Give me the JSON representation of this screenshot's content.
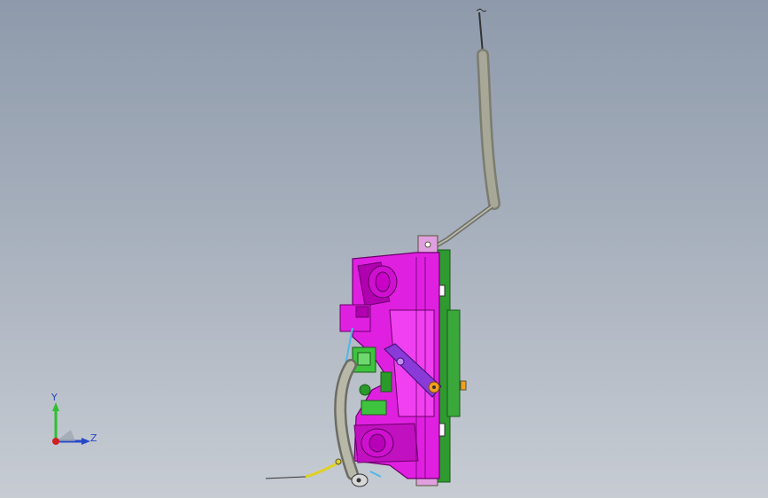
{
  "viewport": {
    "background_top": "#8e9aab",
    "background_bottom": "#c7ccd3"
  },
  "model": {
    "colors": {
      "housing": "#e020e0",
      "housing_shadow": "#b000b0",
      "pcb": "#2f9a2f",
      "cable": "#9a9a8a",
      "lever": "#8a3ad8",
      "knob": "#3ec33e",
      "wire_blue": "#4fb8e8",
      "wire_yellow": "#e0d020",
      "pivot": "#f0a020"
    }
  },
  "triad": {
    "y_label": "Y",
    "z_label": "Z",
    "y_color": "#2fbf2f",
    "z_color": "#2747c9",
    "x_color": "#d02020"
  }
}
